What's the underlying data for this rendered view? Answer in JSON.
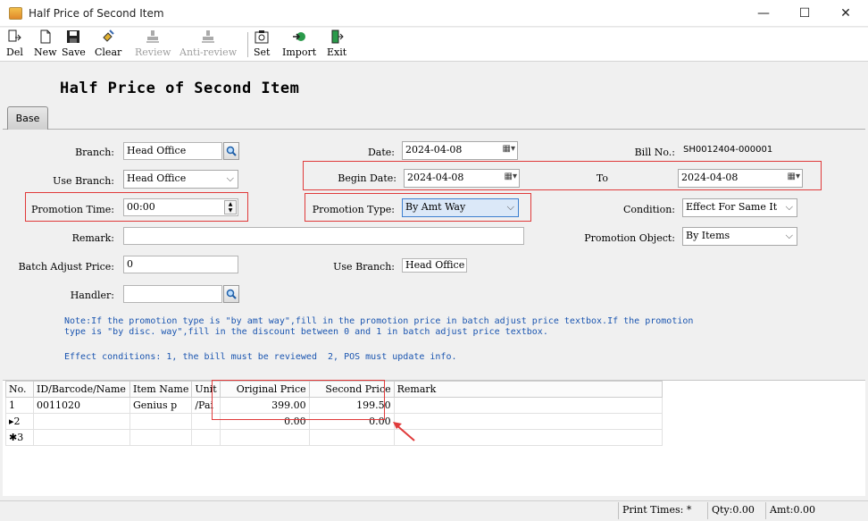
{
  "window": {
    "title": "Half Price of Second Item",
    "minimize": "—",
    "maximize": "☐",
    "close": "✕"
  },
  "toolbar": {
    "del": "Del",
    "new": "New",
    "save": "Save",
    "clear": "Clear",
    "review": "Review",
    "anti_review": "Anti-review",
    "set": "Set",
    "import": "Import",
    "exit": "Exit"
  },
  "page": {
    "title": "Half Price of Second Item",
    "tab_base": "Base"
  },
  "form": {
    "branch_label": "Branch:",
    "branch_value": "Head Office",
    "use_branch_label": "Use Branch:",
    "use_branch_value": "Head Office",
    "promotion_time_label": "Promotion Time:",
    "promotion_time_value": "00:00",
    "remark_label": "Remark:",
    "remark_value": "",
    "batch_adjust_label": "Batch Adjust Price:",
    "batch_adjust_value": "0",
    "handler_label": "Handler:",
    "handler_value": "",
    "date_label": "Date:",
    "date_value": "2024-04-08",
    "begin_date_label": "Begin Date:",
    "begin_date_value": "2024-04-08",
    "promotion_type_label": "Promotion Type:",
    "promotion_type_value": "By Amt Way",
    "use_branch2_label": "Use Branch:",
    "use_branch2_value": "Head Office",
    "bill_no_label": "Bill No.:",
    "bill_no_value": "SH0012404-000001",
    "to_label": "To",
    "to_value": "2024-04-08",
    "condition_label": "Condition:",
    "condition_value": "Effect For Same It",
    "promotion_object_label": "Promotion Object:",
    "promotion_object_value": "By Items"
  },
  "notes": {
    "line1": "Note:If the promotion type is \"by amt way\",fill in the promotion price in batch adjust price textbox.If the promotion",
    "line2": "type is \"by disc. way\",fill in the discount between 0 and 1 in batch adjust price textbox.",
    "line3": "Effect conditions: 1, the bill must be reviewed  2, POS must update info."
  },
  "grid": {
    "columns": [
      "No.",
      "ID/Barcode/Name",
      "Item Name",
      "Unit",
      "Original Price",
      "Second Price",
      "Remark"
    ],
    "rows": [
      {
        "no": "1",
        "id": "0011020",
        "item_name": "Genius p",
        "unit": "/Pai",
        "original_price": "399.00",
        "second_price": "199.50",
        "remark": ""
      },
      {
        "no": "2",
        "id": "",
        "item_name": "",
        "unit": "",
        "original_price": "0.00",
        "second_price": "0.00",
        "remark": ""
      },
      {
        "no": "3",
        "id": "",
        "item_name": "",
        "unit": "",
        "original_price": "",
        "second_price": "",
        "remark": ""
      }
    ]
  },
  "status": {
    "print_times": "Print Times: *",
    "qty": "Qty:0.00",
    "amt": "Amt:0.00"
  },
  "colors": {
    "annotation_red": "#e03a3a",
    "note_blue": "#1a55b0"
  }
}
